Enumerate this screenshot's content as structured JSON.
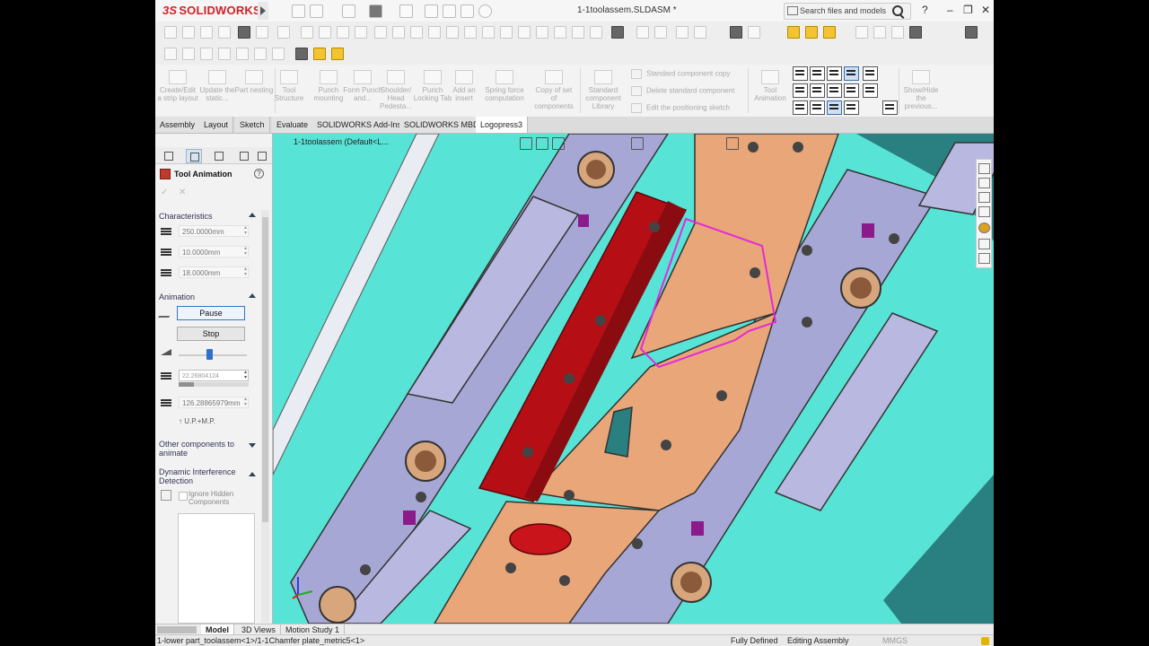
{
  "app": {
    "logo": "SOLIDWORKS",
    "logo_prefix": "3S",
    "document_title": "1-1toolassem.SLDASM *",
    "search_placeholder": "Search files and models",
    "help_glyph": "?",
    "window_buttons": [
      "–",
      "❐",
      "✕"
    ]
  },
  "command_manager": {
    "buttons": [
      {
        "label": "Create/Edit a strip layout"
      },
      {
        "label": "Update the static..."
      },
      {
        "label": "Part nesting"
      },
      {
        "label": "Tool Structure"
      },
      {
        "label": "Punch mounting"
      },
      {
        "label": "Form Punch and..."
      },
      {
        "label": "Shoulder/ Head Pedesta..."
      },
      {
        "label": "Punch Locking Tab"
      },
      {
        "label": "Add an insert"
      },
      {
        "label": "Spring force computation"
      },
      {
        "label": "Copy of set of components"
      },
      {
        "label": "Standard component Library"
      }
    ],
    "row_commands": [
      "Standard component copy",
      "Delete standard component",
      "Edit the positioning sketch"
    ],
    "tool_animation_label": "Tool Animation",
    "show_hide_label": "Show/Hide the previous..."
  },
  "tabs": [
    "Assembly",
    "Layout",
    "Sketch",
    "Evaluate",
    "SOLIDWORKS Add-Ins",
    "SOLIDWORKS MBD",
    "Logopress3"
  ],
  "active_tab": "Logopress3",
  "panel": {
    "title": "Tool Animation",
    "ok_glyph": "✓",
    "cancel_glyph": "✕",
    "characteristics": {
      "header": "Characteristics",
      "fields": [
        "250.0000mm",
        "10.0000mm",
        "18.0000mm"
      ]
    },
    "animation": {
      "header": "Animation",
      "pause_label": "Pause",
      "stop_label": "Stop",
      "speed_fraction": 0.45,
      "position_value": "22.26804124",
      "progress_fraction": 0.22,
      "distance_value": "126.28865979mm",
      "note": "↑ U.P.+M.P."
    },
    "other_components": "Other components to animate",
    "interference": {
      "header": "Dynamic Interference Detection",
      "checkbox_label": "Ignore Hidden Components"
    }
  },
  "viewport": {
    "breadcrumb": "1-1toolassem  (Default<L..."
  },
  "bottom_tabs": [
    "Model",
    "3D Views",
    "Motion Study 1"
  ],
  "status_bar": {
    "selection": "1-lower part_toolassem<1>/1-1Chamfer plate_metric5<1>",
    "definition": "Fully Defined",
    "mode": "Editing Assembly",
    "units": "MMGS"
  },
  "colors": {
    "viewport_bg": "#57e3d6",
    "plate_orange": "#e8a679",
    "rail_lavender": "#a7a7d6",
    "highlight_red": "#b50f15",
    "selection_magenta": "#e32ad8",
    "brand_red": "#d32027"
  }
}
